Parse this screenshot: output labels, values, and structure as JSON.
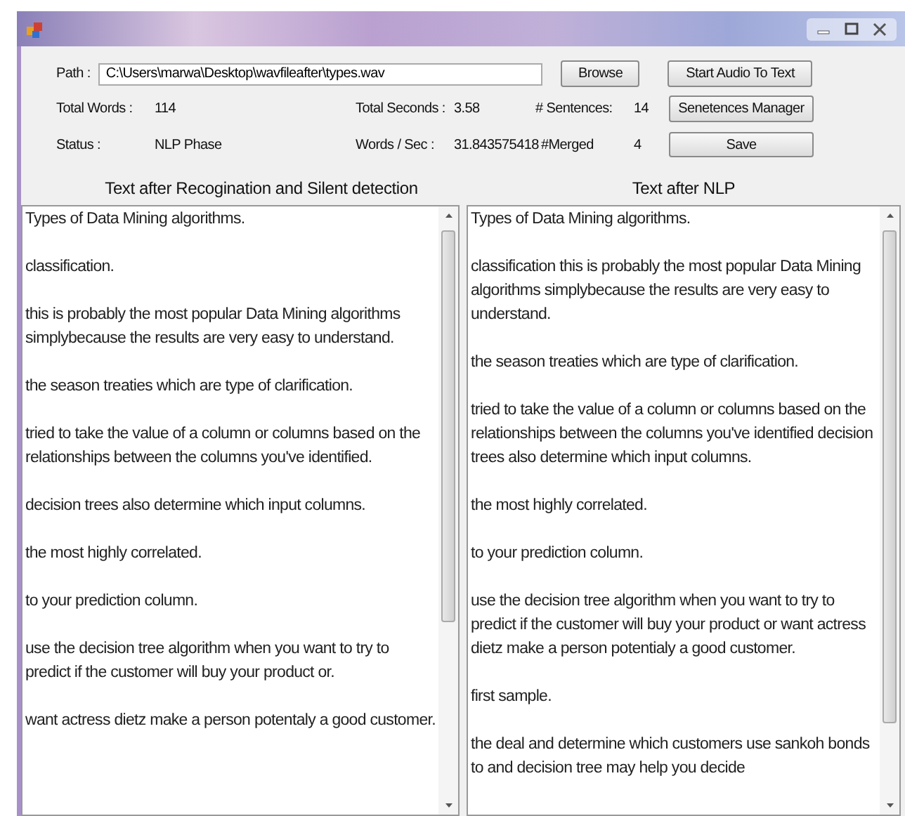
{
  "form": {
    "path_label": "Path :",
    "path_value": "C:\\Users\\marwa\\Desktop\\wavfileafter\\types.wav",
    "browse_button": "Browse",
    "start_button": "Start Audio To Text",
    "manager_button": "Senetences Manager",
    "save_button": "Save",
    "stats": [
      {
        "label": "Total Words :",
        "value": "114"
      },
      {
        "label": "Total Seconds :",
        "value": "3.58"
      },
      {
        "label": "# Sentences:",
        "value": "14"
      },
      {
        "label": "Status :",
        "value": "NLP Phase"
      },
      {
        "label": "Words / Sec :",
        "value": "31.843575418"
      },
      {
        "label": "#Merged",
        "value": "4"
      }
    ]
  },
  "panels": [
    {
      "title": "Text after Recogination and Silent detection",
      "paragraphs": [
        "Types of Data Mining algorithms.",
        "classification.",
        "this is probably the most popular Data Mining algorithms simplybecause the results are very easy to understand.",
        "the season treaties which are type of clarification.",
        "tried to take the value of a column or columns based on the relationships between the columns you've identified.",
        "decision trees also determine which input columns.",
        "the most highly correlated.",
        "to your prediction column.",
        "use the decision tree algorithm when you want to try to predict if the customer will buy your product or.",
        "want actress dietz make a person potentaly a good customer."
      ]
    },
    {
      "title": "Text after NLP",
      "paragraphs": [
        "Types of Data Mining algorithms.",
        "classification this is probably the most popular Data Mining algorithms simplybecause the results are very easy to understand.",
        "the season treaties which are type of clarification.",
        "tried to take the value of a column or columns based on the relationships between the columns you've identified decision trees also determine which input columns.",
        "the most highly correlated.",
        "to your prediction column.",
        "use the decision tree algorithm when you want to try to predict if the customer will buy your product or want actress dietz make a person potentialy a good customer.",
        "first sample.",
        "the deal and determine which customers use sankoh bonds to and decision tree may help you decide"
      ]
    }
  ]
}
